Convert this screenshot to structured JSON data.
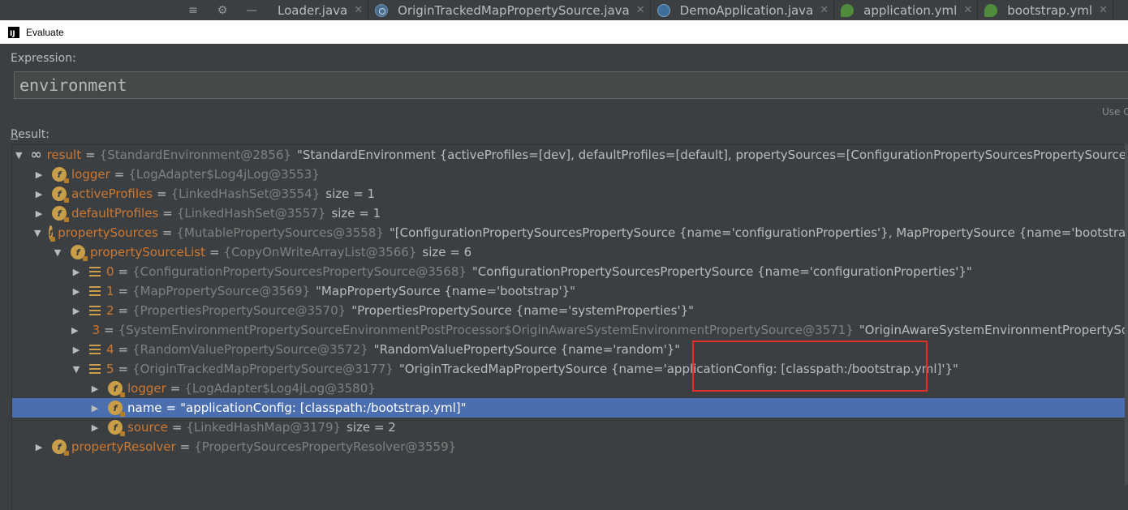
{
  "toolbar": {
    "tools": [
      "collapse-icon",
      "gear-icon",
      "minimize-icon"
    ]
  },
  "tabs": [
    {
      "label": "Loader.java",
      "icon": "java-class-icon"
    },
    {
      "label": "OriginTrackedMapPropertySource.java",
      "icon": "java-class-icon"
    },
    {
      "label": "DemoApplication.java",
      "icon": "run-config-icon"
    },
    {
      "label": "application.yml",
      "icon": "yml-icon"
    },
    {
      "label": "bootstrap.yml",
      "icon": "yml-icon"
    }
  ],
  "dialog": {
    "title": "Evaluate"
  },
  "expression": {
    "label": "Expression:",
    "value": "environment",
    "hint": "Use C"
  },
  "result": {
    "label_first": "R",
    "label_rest": "esult:"
  },
  "tree": [
    {
      "name": "result",
      "type": "{StandardEnvironment@2856}",
      "value": "\"StandardEnvironment {activeProfiles=[dev], defaultProfiles=[default], propertySources=[ConfigurationPropertySourcesPropertySource {name=",
      "icon": "infinity-icon",
      "expanded": true
    },
    {
      "name": "logger",
      "type": "{LogAdapter$Log4jLog@3553}",
      "value": "",
      "icon": "field-icon",
      "expanded": false
    },
    {
      "name": "activeProfiles",
      "type": "{LinkedHashSet@3554}",
      "value": "size = 1",
      "icon": "field-icon",
      "expanded": false
    },
    {
      "name": "defaultProfiles",
      "type": "{LinkedHashSet@3557}",
      "value": "size = 1",
      "icon": "field-icon",
      "expanded": false
    },
    {
      "name": "propertySources",
      "type": "{MutablePropertySources@3558}",
      "value": "\"[ConfigurationPropertySourcesPropertySource {name='configurationProperties'}, MapPropertySource {name='bootstrap'}, P",
      "icon": "field-icon",
      "expanded": true
    },
    {
      "name": "propertySourceList",
      "type": "{CopyOnWriteArrayList@3566}",
      "value": "size = 6",
      "icon": "field-icon",
      "expanded": true
    },
    {
      "name": "0",
      "type": "{ConfigurationPropertySourcesPropertySource@3568}",
      "value": "\"ConfigurationPropertySourcesPropertySource {name='configurationProperties'}\"",
      "icon": "array-element-icon",
      "expanded": false
    },
    {
      "name": "1",
      "type": "{MapPropertySource@3569}",
      "value": "\"MapPropertySource {name='bootstrap'}\"",
      "icon": "array-element-icon",
      "expanded": false
    },
    {
      "name": "2",
      "type": "{PropertiesPropertySource@3570}",
      "value": "\"PropertiesPropertySource {name='systemProperties'}\"",
      "icon": "array-element-icon",
      "expanded": false
    },
    {
      "name": "3",
      "type": "{SystemEnvironmentPropertySourceEnvironmentPostProcessor$OriginAwareSystemEnvironmentPropertySource@3571}",
      "value": "\"OriginAwareSystemEnvironmentPropertySourc",
      "icon": "array-element-icon",
      "expanded": false
    },
    {
      "name": "4",
      "type": "{RandomValuePropertySource@3572}",
      "value": "\"RandomValuePropertySource {name='random'}\"",
      "icon": "array-element-icon",
      "expanded": false
    },
    {
      "name": "5",
      "type": "{OriginTrackedMapPropertySource@3177}",
      "value": "\"OriginTrackedMapPropertySource {name='applicationConfig: [classpath:/bootstrap.yml]'}\"",
      "icon": "array-element-icon",
      "expanded": true
    },
    {
      "name": "logger",
      "type": "{LogAdapter$Log4jLog@3580}",
      "value": "",
      "icon": "field-icon",
      "expanded": false
    },
    {
      "name": "name",
      "type": "\"applicationConfig: [classpath:/bootstrap.yml]\"",
      "value": "",
      "icon": "field-icon",
      "expanded": false,
      "selected": true
    },
    {
      "name": "source",
      "type": "{LinkedHashMap@3179}",
      "value": "size = 2",
      "icon": "field-icon",
      "expanded": false
    },
    {
      "name": "propertyResolver",
      "type": "{PropertySourcesPropertyResolver@3559}",
      "value": "",
      "icon": "field-icon",
      "expanded": false
    }
  ],
  "colors": {
    "background": "#3c3f41",
    "field_name": "#cc7832",
    "type_text": "#808080",
    "selection": "#4b6eaf",
    "highlight_box": "#e0302c"
  }
}
